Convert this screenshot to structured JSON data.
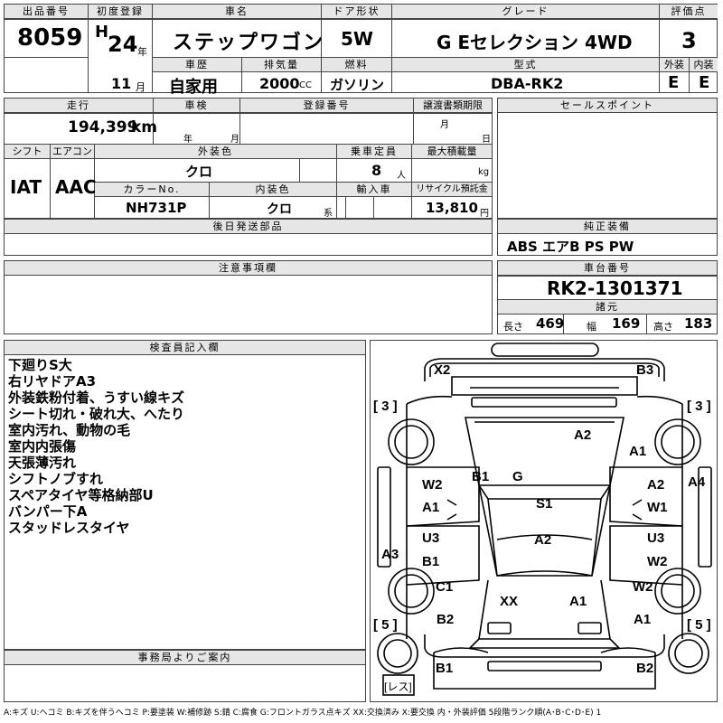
{
  "header": {
    "lot_label": "出品番号",
    "lot": "8059",
    "first_reg_label": "初度登録",
    "era": "H",
    "year": "24",
    "year_unit": "年",
    "month": "11",
    "month_unit": "月",
    "name_label": "車名",
    "car_name": "ステップワゴン",
    "history_label": "車歴",
    "history": "自家用",
    "displacement_label": "排気量",
    "displacement": "2000",
    "cc": "CC",
    "door_label": "ドア形状",
    "door": "5W",
    "fuel_label": "燃料",
    "fuel": "ガソリン",
    "grade_label": "グレード",
    "grade": "G Eセレクション 4WD",
    "model_label": "型式",
    "model": "DBA-RK2",
    "score_label": "評価点",
    "score": "3",
    "ext_label": "外装",
    "ext": "E",
    "int_label": "内装",
    "int": "E"
  },
  "mid": {
    "mileage_label": "走行",
    "mileage": "194,399",
    "km": "km",
    "inspection_label": "車検",
    "year_unit": "年",
    "month_unit": "月",
    "regno_label": "登録番号",
    "transfer_label": "譲渡書類期限",
    "day_unit": "日",
    "shift_label": "シフト",
    "aircon_label": "エアコン",
    "exterior_color_label": "外装色",
    "exterior_color": "クロ",
    "capacity_label": "乗車定員",
    "capacity": "8",
    "person_unit": "人",
    "maxload_label": "最大積載量",
    "kg": "kg",
    "shift": "IAT",
    "aircon": "AAC",
    "colorno_label": "カラーNo.",
    "colorno": "NH731P",
    "interior_color_label": "内装色",
    "interior_color": "クロ",
    "kei": "系",
    "import_label": "輸入車",
    "recycle_label": "リサイクル預託金",
    "recycle": "13,810",
    "yen": "円",
    "later_label": "後日発送部品",
    "sales_label": "セールスポイント",
    "genuine_label": "純正装備",
    "genuine": "ABS エアB PS PW",
    "caution_label": "注意事項欄",
    "chassis_label": "車台番号",
    "chassis": "RK2-1301371",
    "dims_label": "諸元",
    "length_label": "長さ",
    "length": "469",
    "width_label": "幅",
    "width": "169",
    "height_label": "高さ",
    "height": "183"
  },
  "inspector": {
    "label": "検査員記入欄",
    "notes": [
      "下廻りS大",
      "右リヤドアA3",
      "外装鉄粉付着、うすい線キズ",
      "シート切れ・破れ大、へたり",
      "室内汚れ、動物の毛",
      "室内内張傷",
      "天張薄汚れ",
      "シフトノブすれ",
      "スペアタイヤ等格納部U",
      "バンパー下A",
      "スタッドレスタイヤ"
    ]
  },
  "office": {
    "label": "事務局よりご案内"
  },
  "diagram": {
    "marks": {
      "x2": "X2",
      "b3": "B3",
      "t3l": "[ 3 ]",
      "t3r": "[ 3 ]",
      "a2top": "A2",
      "a1r": "A1",
      "w2l": "W2",
      "b1c": "B1",
      "g": "G",
      "a2r": "A2",
      "a4": "A4",
      "a1l": "A1",
      "w1": "W1",
      "s1": "S1",
      "u3l": "U3",
      "u3r": "U3",
      "a2m": "A2",
      "a3": "A3",
      "b1l": "B1",
      "w2r": "W2",
      "c1": "C1",
      "w2r2": "W2",
      "xx": "XX",
      "a1m": "A1",
      "t5l": "[ 5 ]",
      "t5r": "[ 5 ]",
      "b2l": "B2",
      "a1br": "A1",
      "b1b": "B1",
      "b2b": "B2",
      "res": "[レス]"
    }
  },
  "legend": "A:キズ U:ヘコミ B:キズを伴うヘコミ P:要塗装 W:補修跡 S:錆 C:腐食 G:フロントガラス点キズ XX:交換済み X:要交換 内・外装評価 5段階ランク順(A･B･C･D･E) 1"
}
